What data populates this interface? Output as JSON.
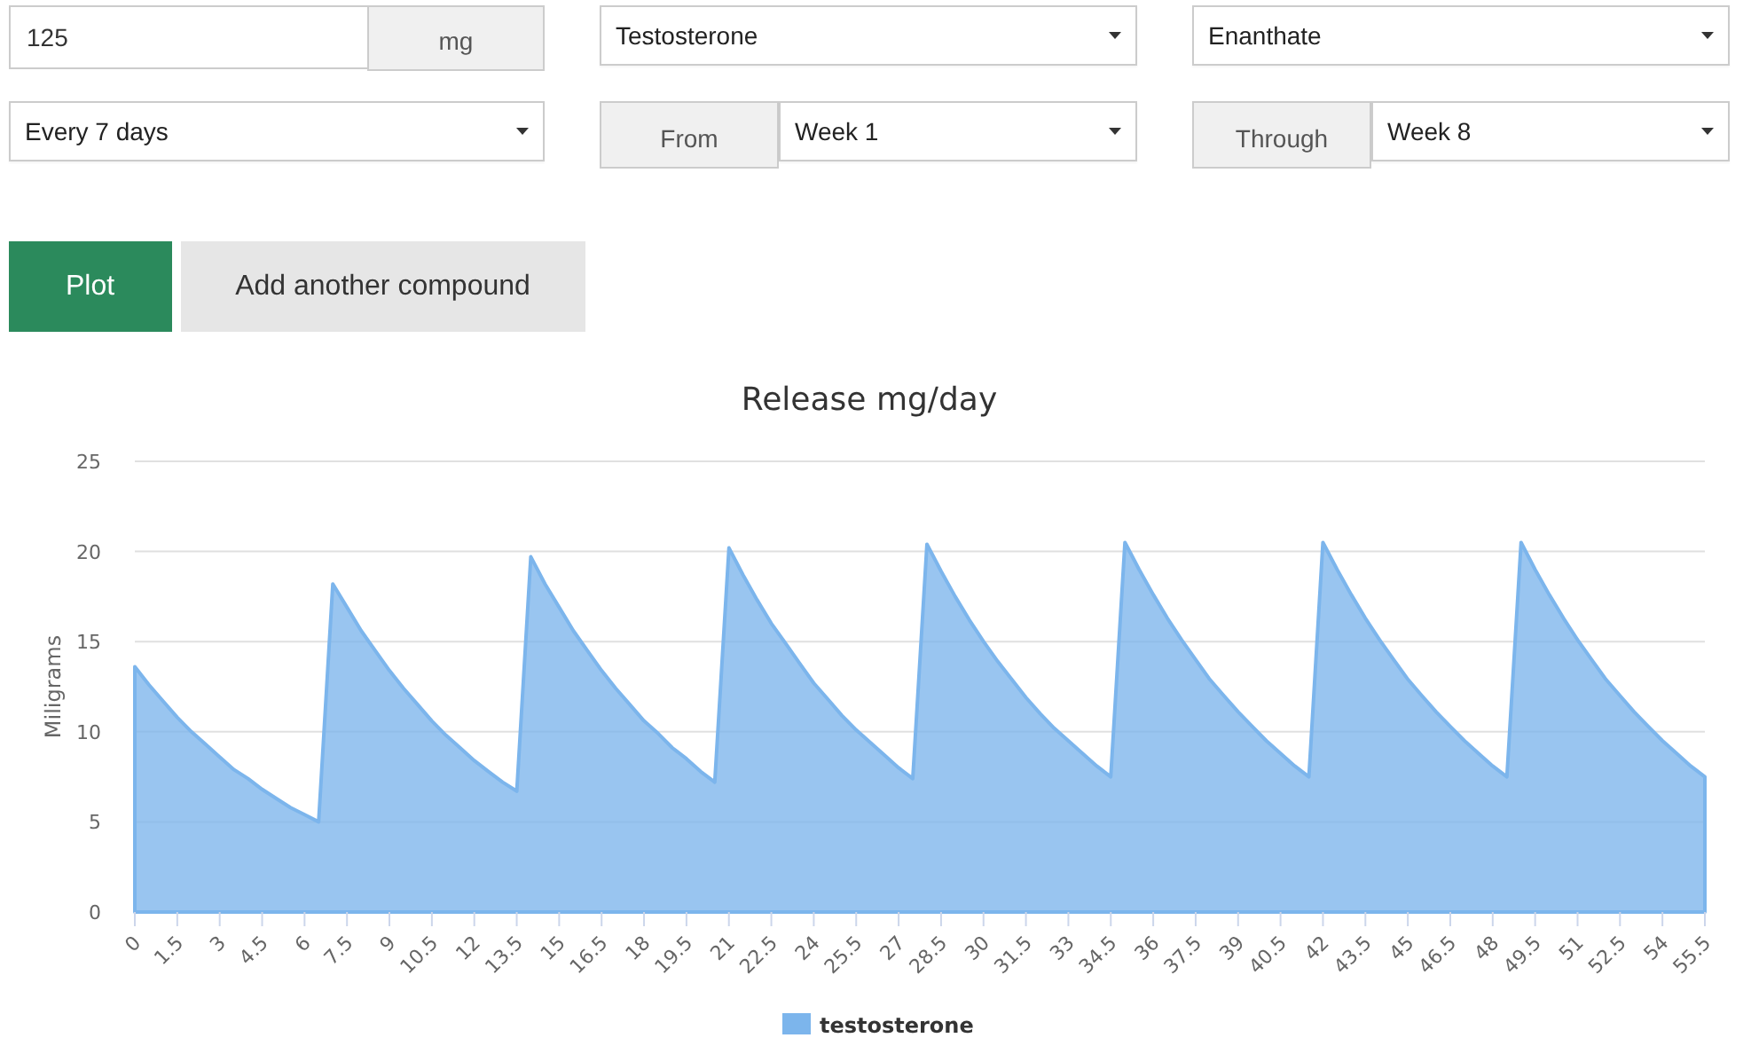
{
  "dose": {
    "value": "125",
    "unit": "mg"
  },
  "compound": {
    "value": "Testosterone"
  },
  "ester": {
    "value": "Enanthate"
  },
  "frequency": {
    "value": "Every 7 days"
  },
  "from": {
    "label": "From",
    "value": "Week 1"
  },
  "through": {
    "label": "Through",
    "value": "Week 8"
  },
  "buttons": [
    {
      "label": "Plot",
      "kind": "primary"
    },
    {
      "label": "Add another compound",
      "kind": "secondary"
    }
  ],
  "chart": {
    "chart_data": {
      "type": "area",
      "title": "Release mg/day",
      "ylabel": "Miligrams",
      "xlim": [
        0,
        55.5
      ],
      "ylim": [
        0,
        25
      ],
      "yticks": [
        0,
        5,
        10,
        15,
        20,
        25
      ],
      "xticks": [
        0,
        1.5,
        3,
        4.5,
        6,
        7.5,
        9,
        10.5,
        12,
        13.5,
        15,
        16.5,
        18,
        19.5,
        21,
        22.5,
        24,
        25.5,
        27,
        28.5,
        30,
        31.5,
        33,
        34.5,
        36,
        37.5,
        39,
        40.5,
        42,
        43.5,
        45,
        46.5,
        48,
        49.5,
        51,
        52.5,
        54,
        55.5
      ],
      "x": [
        0,
        0.5,
        1,
        1.5,
        2,
        2.5,
        3,
        3.5,
        4,
        4.5,
        5,
        5.5,
        6,
        6.5,
        7,
        7.5,
        8,
        8.5,
        9,
        9.5,
        10,
        10.5,
        11,
        11.5,
        12,
        12.5,
        13,
        13.5,
        14,
        14.5,
        15,
        15.5,
        16,
        16.5,
        17,
        17.5,
        18,
        18.5,
        19,
        19.5,
        20,
        20.5,
        21,
        21.5,
        22,
        22.5,
        23,
        23.5,
        24,
        24.5,
        25,
        25.5,
        26,
        26.5,
        27,
        27.5,
        28,
        28.5,
        29,
        29.5,
        30,
        30.5,
        31,
        31.5,
        32,
        32.5,
        33,
        33.5,
        34,
        34.5,
        35,
        35.5,
        36,
        36.5,
        37,
        37.5,
        38,
        38.5,
        39,
        39.5,
        40,
        40.5,
        41,
        41.5,
        42,
        42.5,
        43,
        43.5,
        44,
        44.5,
        45,
        45.5,
        46,
        46.5,
        47,
        47.5,
        48,
        48.5,
        49,
        49.5,
        50,
        50.5,
        51,
        51.5,
        52,
        52.5,
        53,
        53.5,
        54,
        54.5,
        55,
        55.5
      ],
      "grid": true,
      "series": [
        {
          "name": "testosterone",
          "color": "#7cb5ec",
          "values": [
            13.6,
            12.6,
            11.7,
            10.8,
            10.0,
            9.3,
            8.6,
            7.9,
            7.4,
            6.8,
            6.3,
            5.8,
            5.4,
            5.0,
            18.2,
            16.9,
            15.6,
            14.5,
            13.4,
            12.4,
            11.5,
            10.6,
            9.8,
            9.1,
            8.4,
            7.8,
            7.2,
            6.7,
            19.7,
            18.2,
            16.9,
            15.6,
            14.5,
            13.4,
            12.4,
            11.5,
            10.6,
            9.9,
            9.1,
            8.5,
            7.8,
            7.2,
            20.2,
            18.7,
            17.3,
            16.0,
            14.9,
            13.8,
            12.7,
            11.8,
            10.9,
            10.1,
            9.4,
            8.7,
            8.0,
            7.4,
            20.4,
            18.9,
            17.5,
            16.2,
            15.0,
            13.9,
            12.9,
            11.9,
            11.0,
            10.2,
            9.5,
            8.8,
            8.1,
            7.5,
            20.5,
            19.0,
            17.6,
            16.3,
            15.1,
            14.0,
            12.9,
            12.0,
            11.1,
            10.3,
            9.5,
            8.8,
            8.1,
            7.5,
            20.5,
            19.0,
            17.6,
            16.3,
            15.1,
            14.0,
            12.9,
            12.0,
            11.1,
            10.3,
            9.5,
            8.8,
            8.1,
            7.5,
            20.5,
            19.0,
            17.6,
            16.3,
            15.1,
            14.0,
            12.9,
            12.0,
            11.1,
            10.3,
            9.5,
            8.8,
            8.1,
            7.5
          ]
        }
      ]
    }
  }
}
